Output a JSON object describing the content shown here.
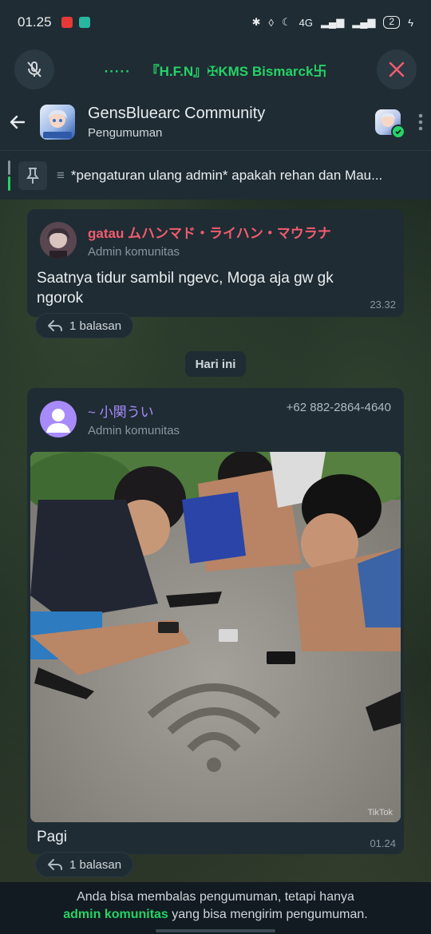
{
  "status_bar": {
    "time": "01.25",
    "battery": "2",
    "network": "4G"
  },
  "call_bar": {
    "dots": "·····",
    "title": "『H.F.N』✠KMS Bismarck卐",
    "mute_icon": "mic-off-icon",
    "close_icon": "close-icon"
  },
  "header": {
    "title": "GensBluearc Community",
    "subtitle": "Pengumuman",
    "group_avatar_text": "GensBluearc"
  },
  "pinned": {
    "text": "*pengaturan ulang admin* apakah rehan dan Mau..."
  },
  "messages": [
    {
      "sender_name": "gatau ムハンマド・ライハン・マウラナ",
      "sender_color": "#f15c6d",
      "sender_role": "Admin komunitas",
      "text": "Saatnya tidur sambil ngevc, Moga aja gw gk ngorok",
      "time": "23.32",
      "replies": "1 balasan"
    },
    {
      "sender_name": "~ 小関うい",
      "sender_color": "#a78bfa",
      "sender_phone": "+62 882-2864-4640",
      "sender_role": "Admin komunitas",
      "caption": "Pagi",
      "time": "01.24",
      "replies": "1 balasan",
      "photo_watermark": "TikTok"
    }
  ],
  "date_separator": "Hari ini",
  "footer": {
    "prefix": "Anda bisa membalas pengumuman, tetapi hanya",
    "admin": "admin komunitas",
    "suffix": "yang bisa mengirim pengumuman."
  }
}
